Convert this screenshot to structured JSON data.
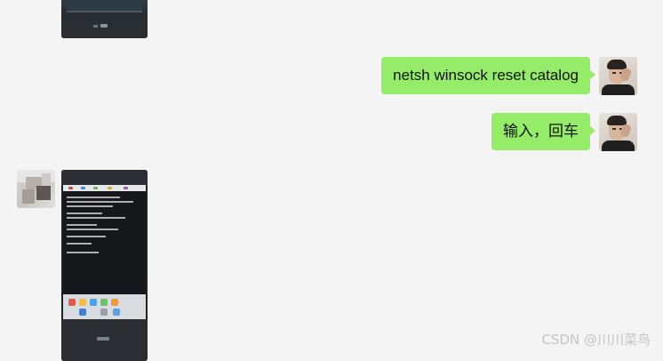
{
  "chat": {
    "messages": [
      {
        "sender": "self",
        "type": "text",
        "text": "netsh winsock reset catalog",
        "bubble_color": "#95ec69"
      },
      {
        "sender": "self",
        "type": "text",
        "text": "输入，回车",
        "bubble_color": "#95ec69"
      },
      {
        "sender": "other",
        "type": "image",
        "content": "laptop-cmd-photo"
      }
    ]
  },
  "background_color": "#f4f4f4",
  "watermark": "CSDN @川川菜鸟"
}
